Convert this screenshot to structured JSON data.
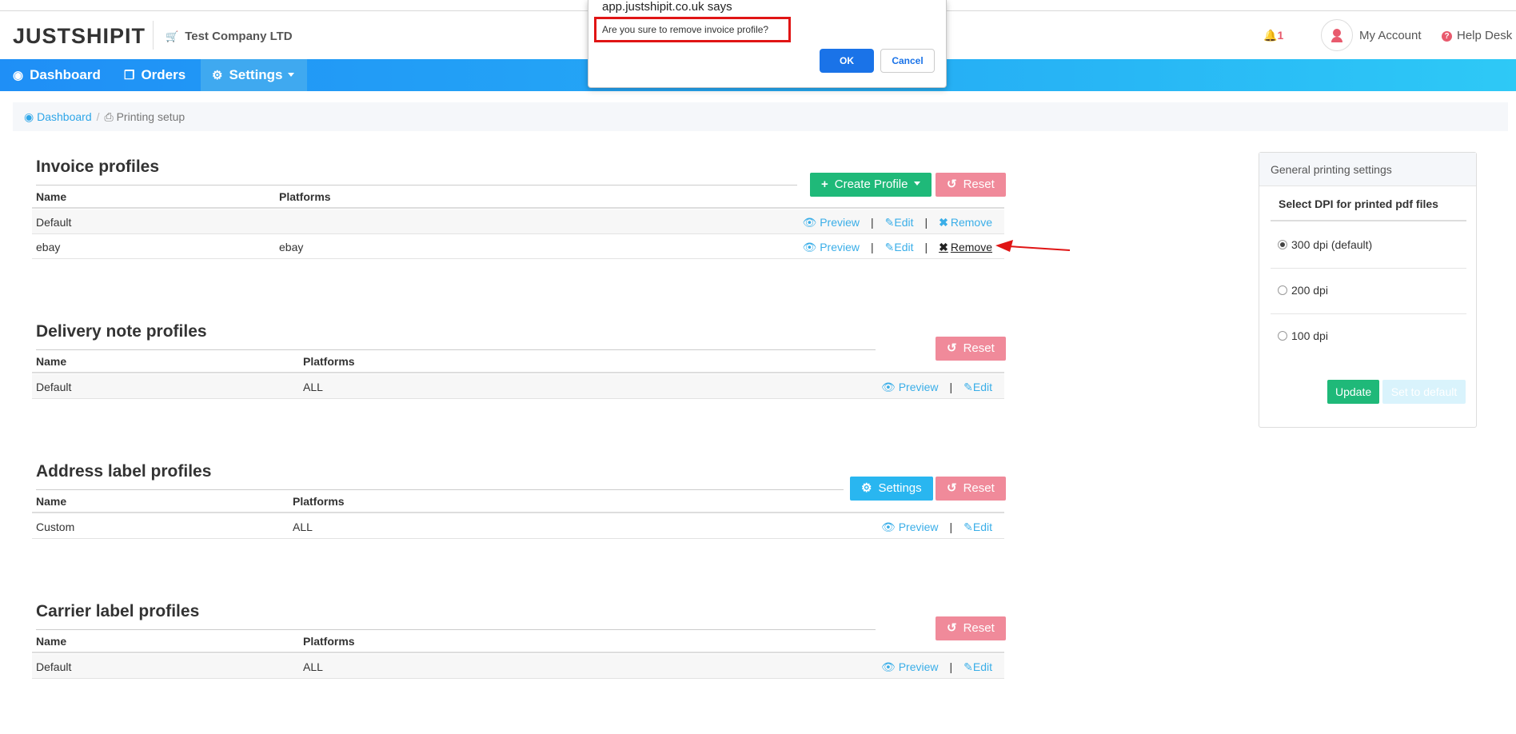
{
  "header": {
    "logo": "JUSTSHIPIT",
    "company": "Test Company LTD",
    "notifications": "1",
    "account": "My Account",
    "help": "Help Desk"
  },
  "nav": {
    "items": [
      {
        "label": "Dashboard",
        "icon": "dashboard-icon"
      },
      {
        "label": "Orders",
        "icon": "copy-icon"
      },
      {
        "label": "Settings",
        "icon": "gear-icon",
        "active": true
      }
    ]
  },
  "breadcrumb": {
    "home": "Dashboard",
    "separator": "/",
    "current": "Printing setup"
  },
  "common": {
    "col_name": "Name",
    "col_platforms": "Platforms",
    "preview": "Preview",
    "edit": "Edit",
    "remove": "Remove",
    "reset": "Reset",
    "pipe": "|"
  },
  "invoice": {
    "title": "Invoice profiles",
    "create": "Create Profile",
    "rows": [
      {
        "name": "Default",
        "platforms": ""
      },
      {
        "name": "ebay",
        "platforms": "ebay"
      }
    ]
  },
  "delivery": {
    "title": "Delivery note profiles",
    "rows": [
      {
        "name": "Default",
        "platforms": "ALL"
      }
    ]
  },
  "address": {
    "title": "Address label profiles",
    "settings": "Settings",
    "rows": [
      {
        "name": "Custom",
        "platforms": "ALL"
      }
    ]
  },
  "carrier": {
    "title": "Carrier label profiles",
    "rows": [
      {
        "name": "Default",
        "platforms": "ALL"
      }
    ]
  },
  "panel": {
    "title": "General printing settings",
    "subtitle": "Select DPI for printed pdf files",
    "options": [
      {
        "label": "300 dpi (default)",
        "selected": true
      },
      {
        "label": "200 dpi",
        "selected": false
      },
      {
        "label": "100 dpi",
        "selected": false
      }
    ],
    "update": "Update",
    "set_default": "Set to default"
  },
  "dialog": {
    "title": "app.justshipit.co.uk says",
    "message": "Are you sure to remove invoice profile?",
    "ok": "OK",
    "cancel": "Cancel"
  },
  "colors": {
    "nav_gradient_start": "#1f8ff6",
    "nav_gradient_end": "#2ec9f6",
    "green": "#1fb979",
    "reset_red": "#f08a9a",
    "link_blue": "#3aaee8",
    "alert_red": "#e01515"
  }
}
